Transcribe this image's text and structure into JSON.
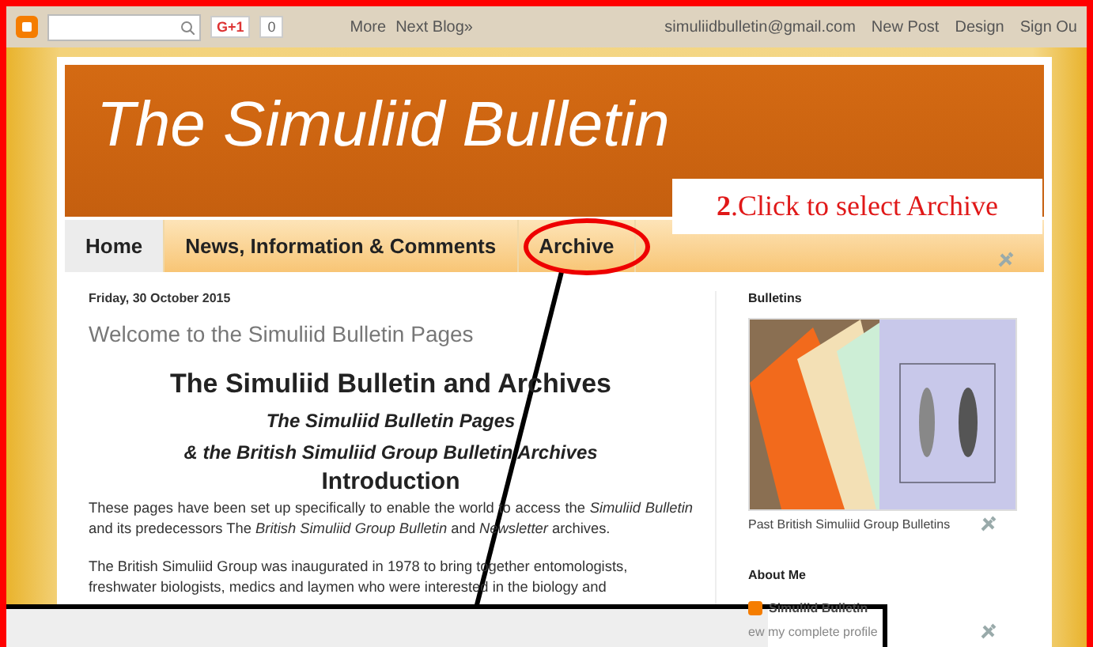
{
  "navbar": {
    "gplus": "G+1",
    "gplus_count": "0",
    "links": [
      "More",
      "Next Blog»"
    ],
    "account": "simuliidbulletin@gmail.com",
    "actions": [
      "New Post",
      "Design",
      "Sign Ou"
    ]
  },
  "header": {
    "title": "The Simuliid Bulletin"
  },
  "tabs": [
    {
      "label": "Home",
      "selected": true
    },
    {
      "label": "News, Information & Comments",
      "selected": false
    },
    {
      "label": "Archive",
      "selected": false
    }
  ],
  "annotation": {
    "text": "**2**.Click to select Archive"
  },
  "post": {
    "date": "Friday, 30 October 2015",
    "title": "Welcome to the Simuliid Bulletin Pages",
    "heading": "The Simuliid Bulletin and Archives",
    "subtitles": [
      "The Simuliid Bulletin Pages",
      "& the British Simuliid Group Bulletin Archives"
    ],
    "section": "Introduction",
    "paragraph": "These pages have been set up specifically to enable the world to access the *Simuliid Bulletin* and its predecessors The *British Simuliid Group Bulletin* and *Newsletter* archives.",
    "lines": [
      "The British Simuliid Group was inaugurated in 1978 to bring together entomologists,",
      "freshwater biologists, medics and laymen who were interested in the biology and"
    ]
  },
  "sidebar": {
    "bulletins": {
      "title": "Bulletins",
      "caption": "Past British Simuliid Group Bulletins"
    },
    "about": {
      "title": "About Me",
      "name": "Simuliid Bulletin",
      "link": "ew my complete profile"
    }
  }
}
